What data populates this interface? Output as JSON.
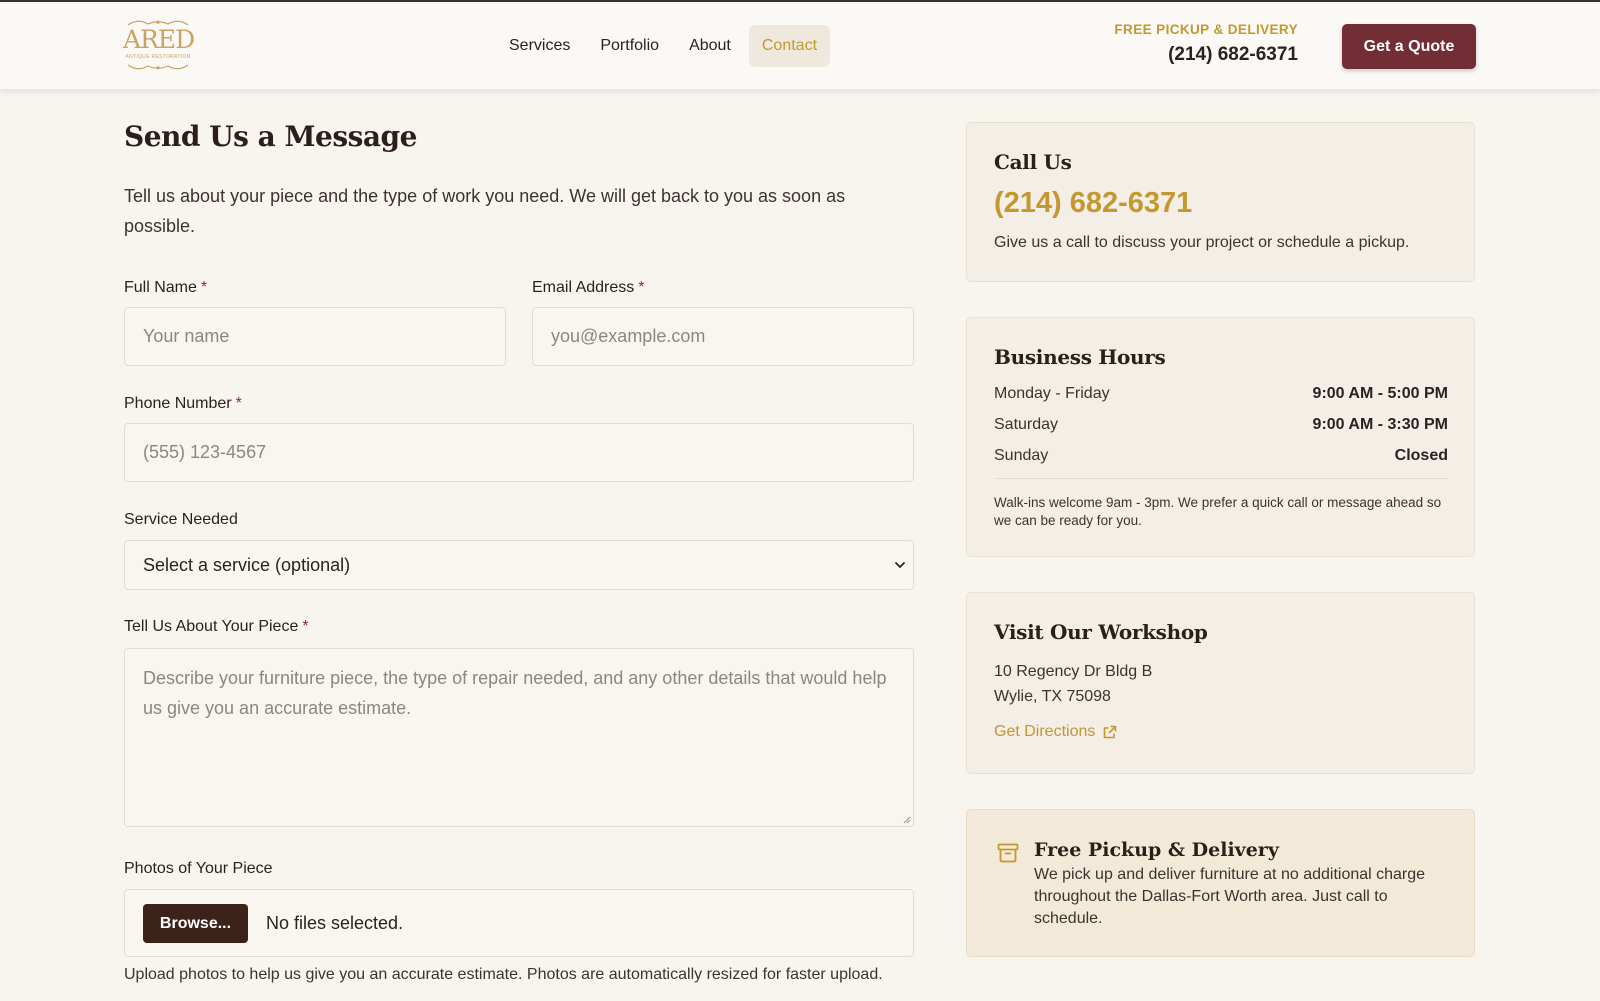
{
  "header": {
    "logo": {
      "text": "ARED",
      "subtext": "ANTIQUE RESTORATION"
    },
    "nav": [
      {
        "label": "Services"
      },
      {
        "label": "Portfolio"
      },
      {
        "label": "About"
      },
      {
        "label": "Contact",
        "active": true
      }
    ],
    "pickup_label": "FREE PICKUP & DELIVERY",
    "phone": "(214) 682-6371",
    "quote_button": "Get a Quote"
  },
  "form": {
    "title": "Send Us a Message",
    "intro": "Tell us about your piece and the type of work you need. We will get back to you as soon as possible.",
    "required_marker": "*",
    "full_name": {
      "label": "Full Name",
      "placeholder": "Your name",
      "value": ""
    },
    "email": {
      "label": "Email Address",
      "placeholder": "you@example.com",
      "value": ""
    },
    "phone": {
      "label": "Phone Number",
      "placeholder": "(555) 123-4567",
      "value": ""
    },
    "service": {
      "label": "Service Needed",
      "selected": "Select a service (optional)"
    },
    "piece": {
      "label": "Tell Us About Your Piece",
      "placeholder": "Describe your furniture piece, the type of repair needed, and any other details that would help us give you an accurate estimate.",
      "value": ""
    },
    "photos": {
      "label": "Photos of Your Piece",
      "browse_label": "Browse...",
      "status": "No files selected.",
      "help": "Upload photos to help us give you an accurate estimate. Photos are automatically resized for faster upload."
    }
  },
  "sidebar": {
    "call": {
      "title": "Call Us",
      "phone": "(214) 682-6371",
      "text": "Give us a call to discuss your project or schedule a pickup."
    },
    "hours": {
      "title": "Business Hours",
      "rows": [
        {
          "day": "Monday - Friday",
          "time": "9:00 AM - 5:00 PM"
        },
        {
          "day": "Saturday",
          "time": "9:00 AM - 3:30 PM"
        },
        {
          "day": "Sunday",
          "time": "Closed"
        }
      ],
      "note": "Walk-ins welcome 9am - 3pm. We prefer a quick call or message ahead so we can be ready for you."
    },
    "visit": {
      "title": "Visit Our Workshop",
      "address_line1": "10 Regency Dr Bldg B",
      "address_line2": "Wylie, TX 75098",
      "directions_label": "Get Directions",
      "directions_icon": "external-link-icon"
    },
    "pickup": {
      "icon": "archive-box-icon",
      "title": "Free Pickup & Delivery",
      "text": "We pick up and deliver furniture at no additional charge throughout the Dallas-Fort Worth area. Just call to schedule."
    }
  },
  "colors": {
    "accent_gold": "#c4972f",
    "brand_maroon": "#722d35",
    "dark_brown": "#3c2219",
    "background": "#f8f5ef"
  }
}
